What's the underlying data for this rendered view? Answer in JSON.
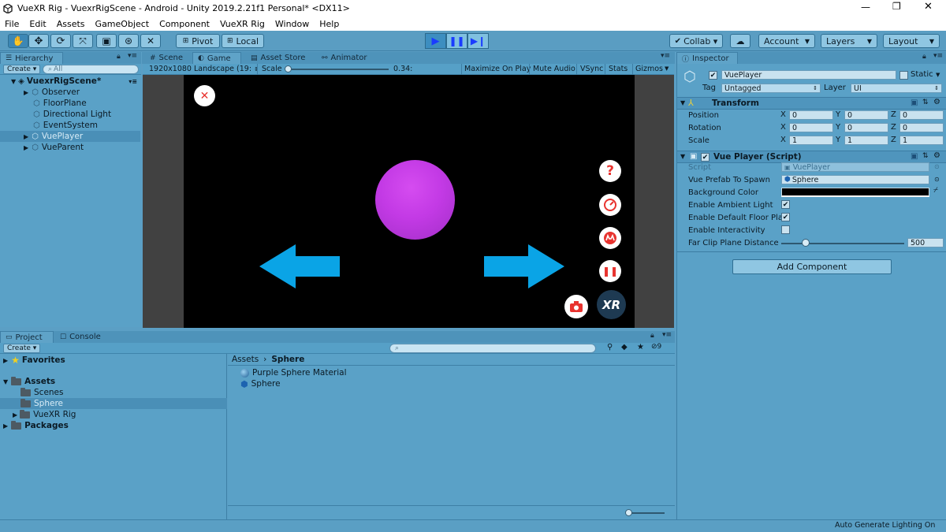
{
  "window": {
    "title": "VueXR Rig - VuexrRigScene - Android - Unity 2019.2.21f1 Personal* <DX11>",
    "minimize": "—",
    "maximize": "❐",
    "close": "✕"
  },
  "menu": [
    "File",
    "Edit",
    "Assets",
    "GameObject",
    "Component",
    "VueXR Rig",
    "Window",
    "Help"
  ],
  "toolbar": {
    "pivot": "Pivot",
    "local": "Local",
    "collab": "Collab ▾",
    "account": "Account",
    "layers": "Layers",
    "layout": "Layout"
  },
  "hierarchy": {
    "tab": "Hierarchy",
    "create": "Create ▾",
    "search_placeholder": "All",
    "scene": "VuexrRigScene*",
    "items": [
      "Observer",
      "FloorPlane",
      "Directional Light",
      "EventSystem",
      "VuePlayer",
      "VueParent"
    ]
  },
  "center_tabs": [
    "Scene",
    "Game",
    "Asset Store",
    "Animator"
  ],
  "game_bar": {
    "resolution": "1920x1080 Landscape (19:",
    "scale_label": "Scale",
    "scale_value": "0.34:",
    "maximize": "Maximize On Play",
    "mute": "Mute Audio",
    "vsync": "VSync",
    "stats": "Stats",
    "gizmos": "Gizmos"
  },
  "game": {
    "sphere_color": "#c93ae8",
    "arrow_color": "#0aa4e6",
    "button_accent": "#e8332f",
    "xr_logo": "XR"
  },
  "bottom_tabs": [
    "Project",
    "Console"
  ],
  "project": {
    "create": "Create ▾",
    "filter_count": "9",
    "tree": {
      "favorites": "Favorites",
      "assets": "Assets",
      "scenes": "Scenes",
      "sphere": "Sphere",
      "vuexr": "VueXR Rig",
      "packages": "Packages"
    },
    "breadcrumb": {
      "root": "Assets",
      "current": "Sphere"
    },
    "files": [
      "Purple Sphere Material",
      "Sphere"
    ]
  },
  "inspector": {
    "tab": "Inspector",
    "object_name": "VuePlayer",
    "static": "Static",
    "tag_label": "Tag",
    "tag_value": "Untagged",
    "layer_label": "Layer",
    "layer_value": "UI",
    "transform": {
      "title": "Transform",
      "rows": [
        {
          "label": "Position",
          "x": "0",
          "y": "0",
          "z": "0"
        },
        {
          "label": "Rotation",
          "x": "0",
          "y": "0",
          "z": "0"
        },
        {
          "label": "Scale",
          "x": "1",
          "y": "1",
          "z": "1"
        }
      ]
    },
    "script": {
      "title": "Vue Player (Script)",
      "script_label": "Script",
      "script_value": "VuePlayer",
      "prefab_label": "Vue Prefab To Spawn",
      "prefab_value": "Sphere",
      "bg_label": "Background Color",
      "bg_color": "#000000",
      "ambient_label": "Enable Ambient Light",
      "ambient": true,
      "floor_label": "Enable Default Floor Pla",
      "floor": true,
      "interact_label": "Enable Interactivity",
      "interact": false,
      "clip_label": "Far Clip Plane Distance",
      "clip_value": "500",
      "clip_fraction": 0.2
    },
    "add_component": "Add Component"
  },
  "status": "Auto Generate Lighting On"
}
